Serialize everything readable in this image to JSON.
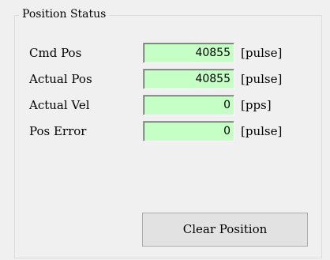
{
  "group": {
    "title": "Position Status"
  },
  "rows": [
    {
      "label": "Cmd Pos",
      "value": "40855",
      "unit": "[pulse]"
    },
    {
      "label": "Actual Pos",
      "value": "40855",
      "unit": "[pulse]"
    },
    {
      "label": "Actual Vel",
      "value": "0",
      "unit": "[pps]"
    },
    {
      "label": "Pos Error",
      "value": "0",
      "unit": "[pulse]"
    }
  ],
  "clear_button": {
    "label": "Clear Position"
  },
  "colors": {
    "panel_background": "#f0f0f0",
    "value_field_background": "#c6ffc6",
    "button_background": "#e2e2e2"
  }
}
